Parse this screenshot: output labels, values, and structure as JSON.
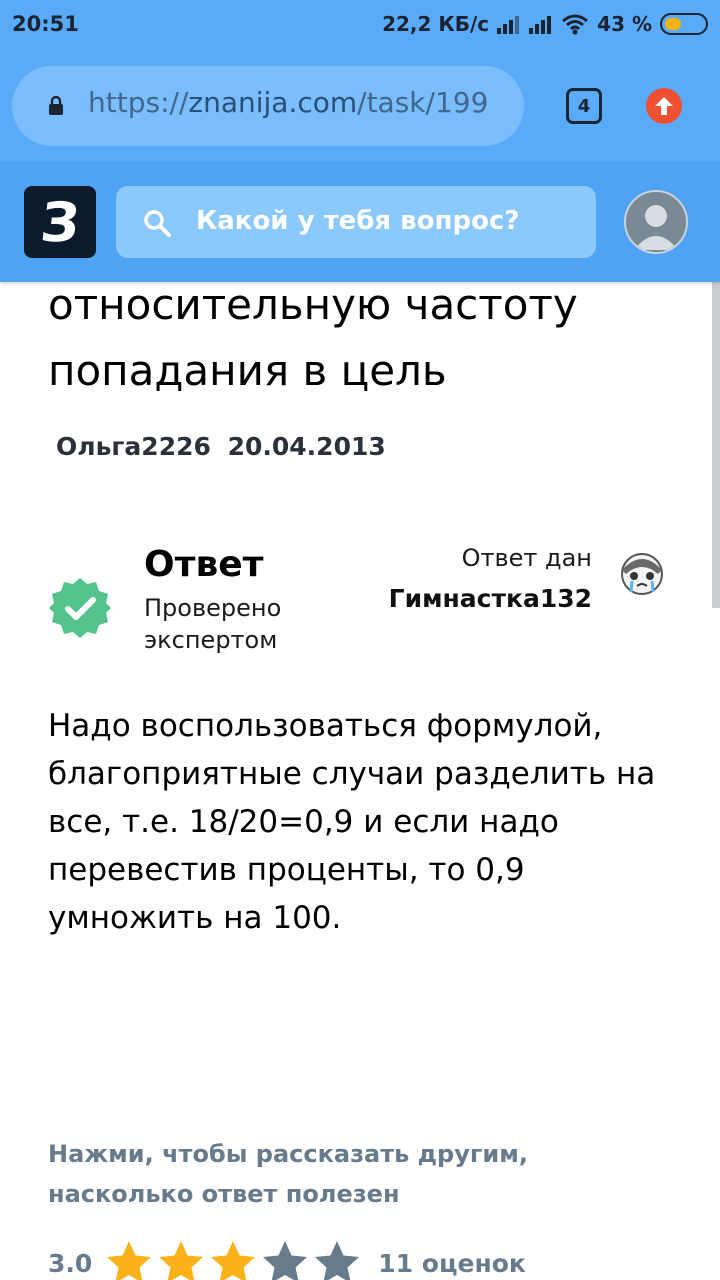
{
  "status_bar": {
    "time": "20:51",
    "speed": "22,2 КБ/с",
    "battery": "43 %",
    "battery_level": 0.43
  },
  "browser": {
    "url_scheme": "https://",
    "url_host": "znanija.com",
    "url_path": "/task/199",
    "tab_count": "4",
    "icons": [
      "lock-icon",
      "update-icon"
    ]
  },
  "header": {
    "logo_letter": "З",
    "search_placeholder": "Какой у тебя вопрос?",
    "icons": [
      "search-icon",
      "user-avatar"
    ]
  },
  "question": {
    "text_tail": "относительную частоту попадания в цель",
    "author": "Ольга2226",
    "date": "20.04.2013"
  },
  "answer": {
    "heading": "Ответ",
    "verified_text": "Проверено экспертом",
    "answered_by_label": "Ответ дан",
    "answerer": "Гимнастка132",
    "text": "Надо воспользоваться формулой, благоприятные случаи разделить на все, т.е. 18/20=0,9 и если надо перевестив проценты, то 0,9 умножить на 100."
  },
  "rating": {
    "prompt": "Нажми, чтобы рассказать другим, насколько ответ полезен",
    "value": "3.0",
    "stars_filled": 3,
    "stars_total": 5,
    "count": "11 оценок",
    "colors": {
      "filled": "#fbb21a",
      "empty": "#687b8c"
    }
  }
}
